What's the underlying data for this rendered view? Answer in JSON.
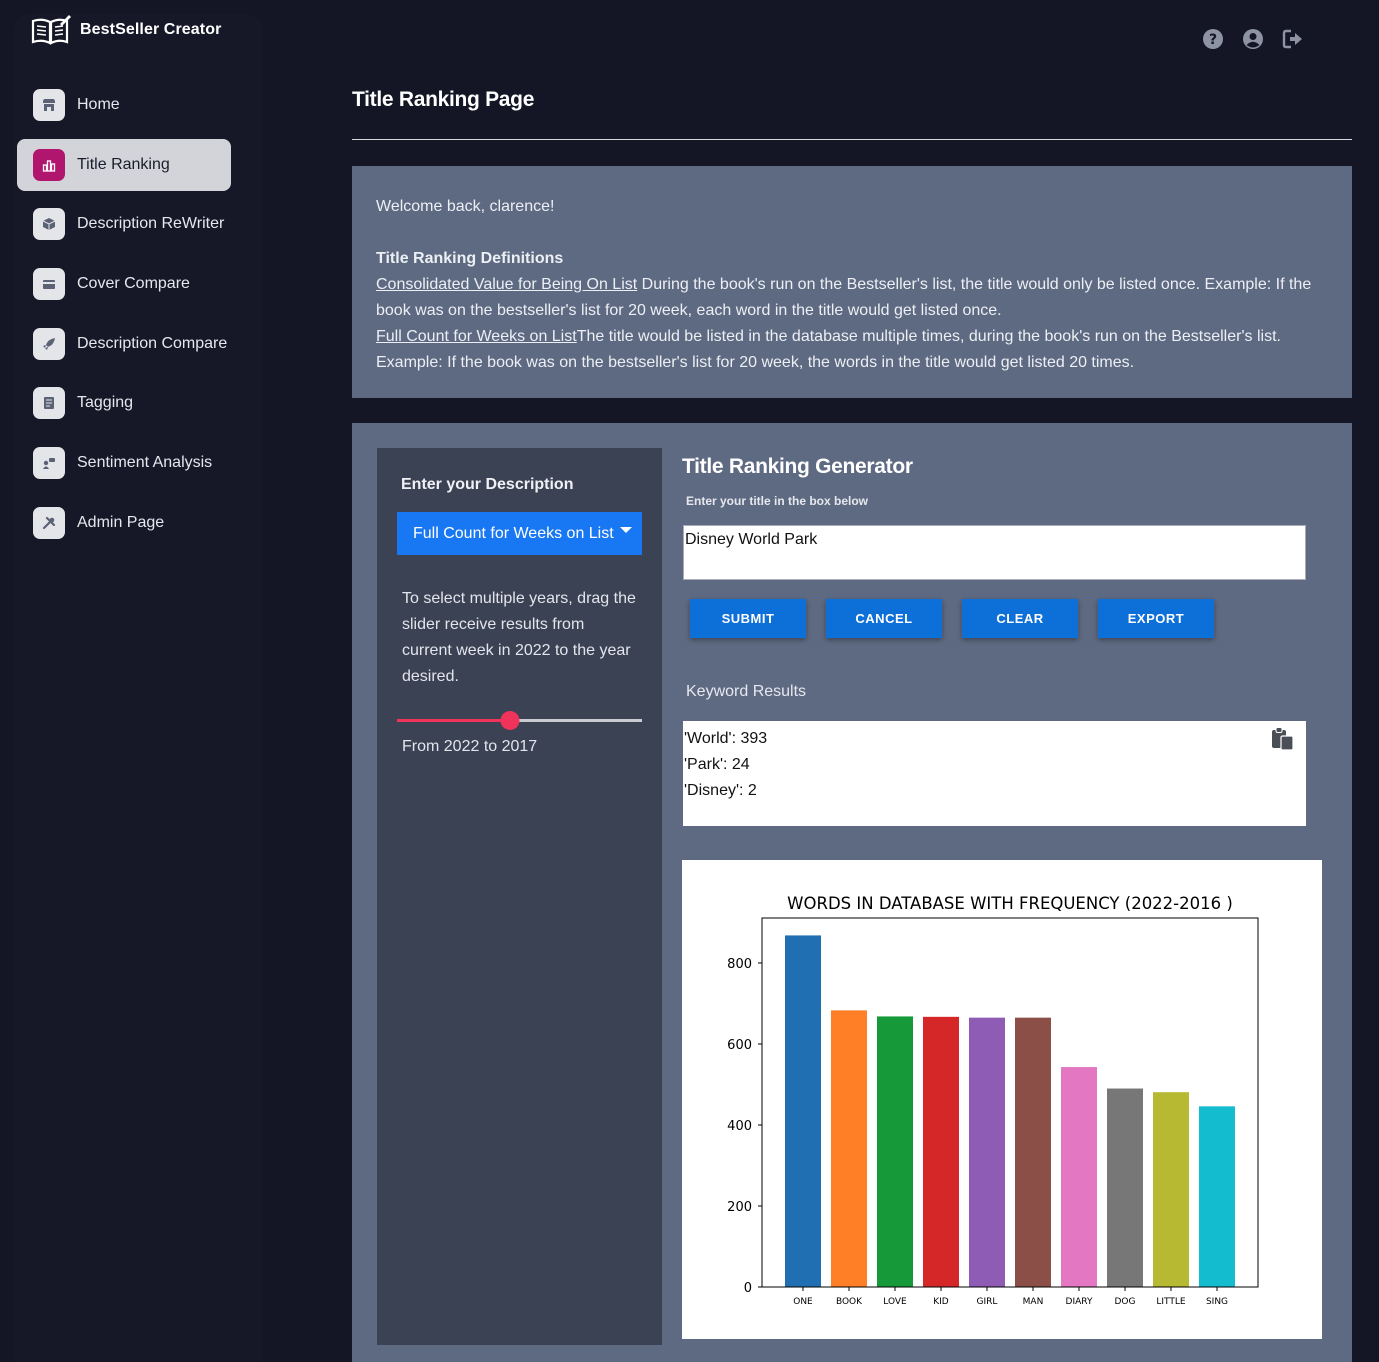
{
  "brand": {
    "name": "BestSeller Creator",
    "logo_icon": "open-book-icon"
  },
  "sidebar": {
    "items": [
      {
        "label": "Home",
        "icon": "store-icon",
        "active": false
      },
      {
        "label": "Title Ranking",
        "icon": "chart-icon",
        "active": true
      },
      {
        "label": "Description ReWriter",
        "icon": "cube-icon",
        "active": false
      },
      {
        "label": "Cover Compare",
        "icon": "card-icon",
        "active": false
      },
      {
        "label": "Description Compare",
        "icon": "rocket-icon",
        "active": false
      },
      {
        "label": "Tagging",
        "icon": "document-icon",
        "active": false
      },
      {
        "label": "Sentiment Analysis",
        "icon": "chat-icon",
        "active": false
      },
      {
        "label": "Admin Page",
        "icon": "tools-icon",
        "active": false
      }
    ]
  },
  "header": {
    "icons": [
      "help-icon",
      "user-icon",
      "logout-icon"
    ]
  },
  "page": {
    "title": "Title Ranking Page"
  },
  "info": {
    "welcome": "Welcome back, clarence!",
    "definitions_heading": "Title Ranking Definitions",
    "def1_link": "Consolidated Value for Being On List",
    "def1_text": " During the book's run on the Bestseller's list, the title would only be listed once. Example: If the book was on the bestseller's list for 20 week, each word in the title would get listed once.",
    "def2_link": "Full Count for Weeks on List",
    "def2_text": "The title would be listed in the database multiple times, during the book's run on the Bestseller's list. Example: If the book was on the bestseller's list for 20 week, the words in the title would get listed 20 times."
  },
  "left_panel": {
    "title": "Enter your Description",
    "dropdown_selected": "Full Count for Weeks on List",
    "help_text": "To select multiple years, drag the slider receive results from current week in 2022 to the year desired.",
    "slider_level": 0.46,
    "slider_readout": "From 2022 to 2017"
  },
  "generator": {
    "title": "Title Ranking Generator",
    "subtitle": "Enter your title in the box below",
    "input_value": "Disney World Park",
    "buttons": [
      "SUBMIT",
      "CANCEL",
      "CLEAR",
      "EXPORT"
    ],
    "keyword_label": "Keyword Results",
    "keywords": [
      "'World': 393",
      "'Park': 24",
      "'Disney': 2"
    ]
  },
  "chart_data": {
    "type": "bar",
    "title": "WORDS IN DATABASE WITH FREQUENCY (2022-2016 )",
    "xlabel": "",
    "ylabel": "",
    "categories": [
      "ONE",
      "BOOK",
      "LOVE",
      "KID",
      "GIRL",
      "MAN",
      "DIARY",
      "DOG",
      "LITTLE",
      "SING"
    ],
    "values": [
      868,
      683,
      668,
      667,
      665,
      665,
      543,
      490,
      481,
      446
    ],
    "colors": [
      "#1f6fb2",
      "#ff7f27",
      "#169a39",
      "#d62728",
      "#8f5cb5",
      "#8c4f47",
      "#e377c2",
      "#777777",
      "#b7b932",
      "#14bcd0"
    ],
    "yticks": [
      0,
      200,
      400,
      600,
      800
    ],
    "ylim": [
      0,
      911
    ],
    "grid": false,
    "legend": "none"
  }
}
